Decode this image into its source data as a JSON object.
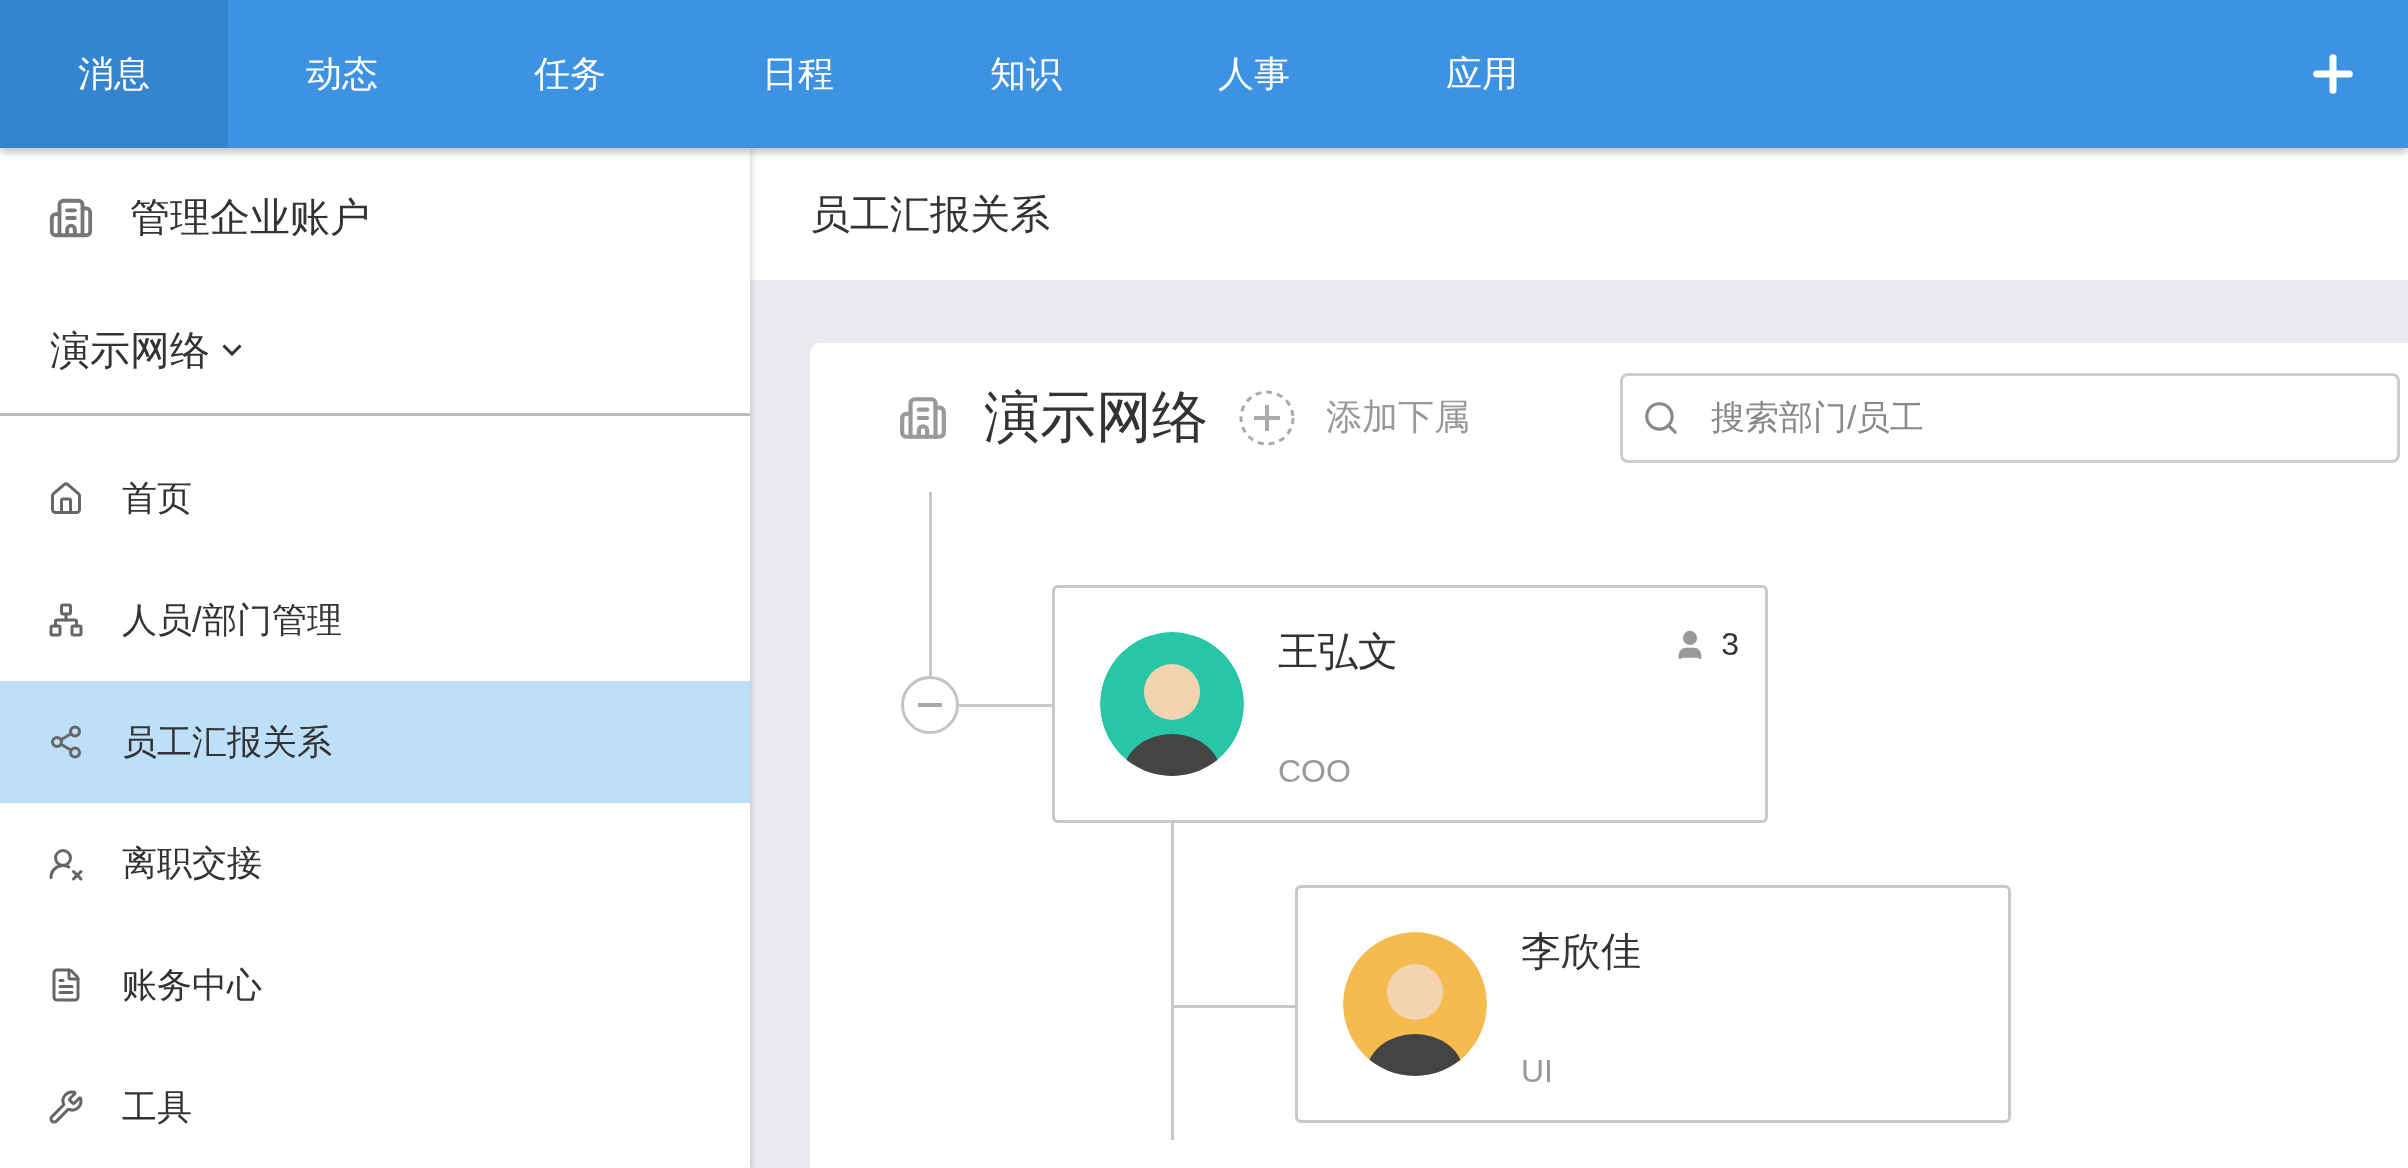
{
  "top_nav": {
    "tabs": [
      {
        "label": "消息",
        "selected": true
      },
      {
        "label": "动态",
        "selected": false
      },
      {
        "label": "任务",
        "selected": false
      },
      {
        "label": "日程",
        "selected": false
      },
      {
        "label": "知识",
        "selected": false
      },
      {
        "label": "人事",
        "selected": false
      },
      {
        "label": "应用",
        "selected": false
      }
    ]
  },
  "sidebar": {
    "account": "管理企业账户",
    "organization": "演示网络",
    "items": [
      {
        "label": "首页",
        "selected": false
      },
      {
        "label": "人员/部门管理",
        "selected": false
      },
      {
        "label": "员工汇报关系",
        "selected": true
      },
      {
        "label": "离职交接",
        "selected": false
      },
      {
        "label": "账务中心",
        "selected": false
      },
      {
        "label": "工具",
        "selected": false
      }
    ]
  },
  "main": {
    "title": "员工汇报关系",
    "org_chart": {
      "title": "演示网络",
      "add_label": "添加下属",
      "search_placeholder": "搜索部门/员工",
      "root": {
        "name": "王弘文",
        "role": "COO",
        "report_count": "3",
        "color": "#26c6a6",
        "expanded": true,
        "children": [
          {
            "name": "李欣佳",
            "role": "UI",
            "color": "#f5bb4e"
          }
        ]
      }
    }
  }
}
